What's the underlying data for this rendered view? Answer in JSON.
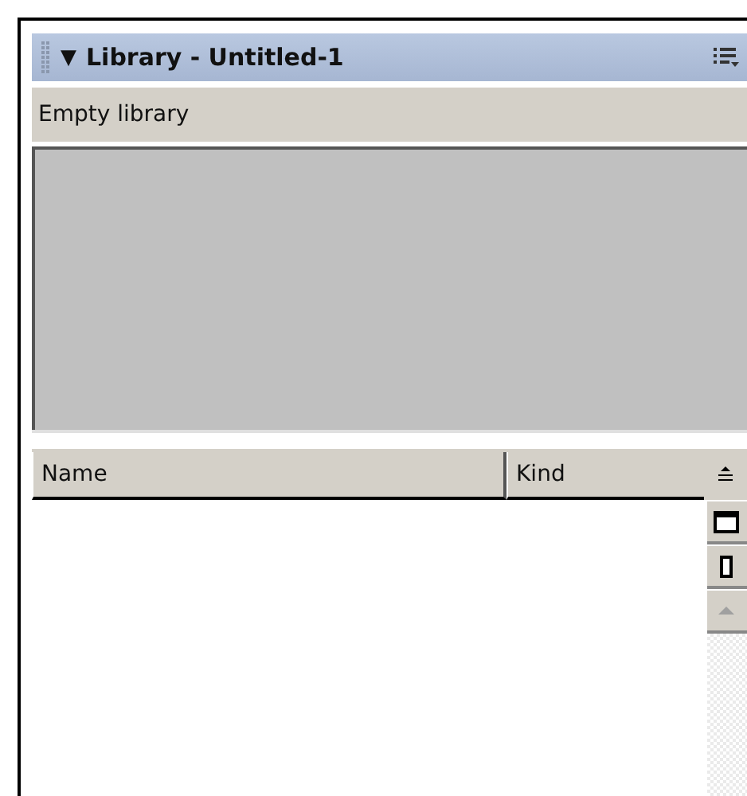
{
  "panel": {
    "toggle": "▼",
    "title": "Library - Untitled-1",
    "status": "Empty library"
  },
  "table": {
    "columns": [
      {
        "label": "Name"
      },
      {
        "label": "Kind"
      }
    ]
  }
}
